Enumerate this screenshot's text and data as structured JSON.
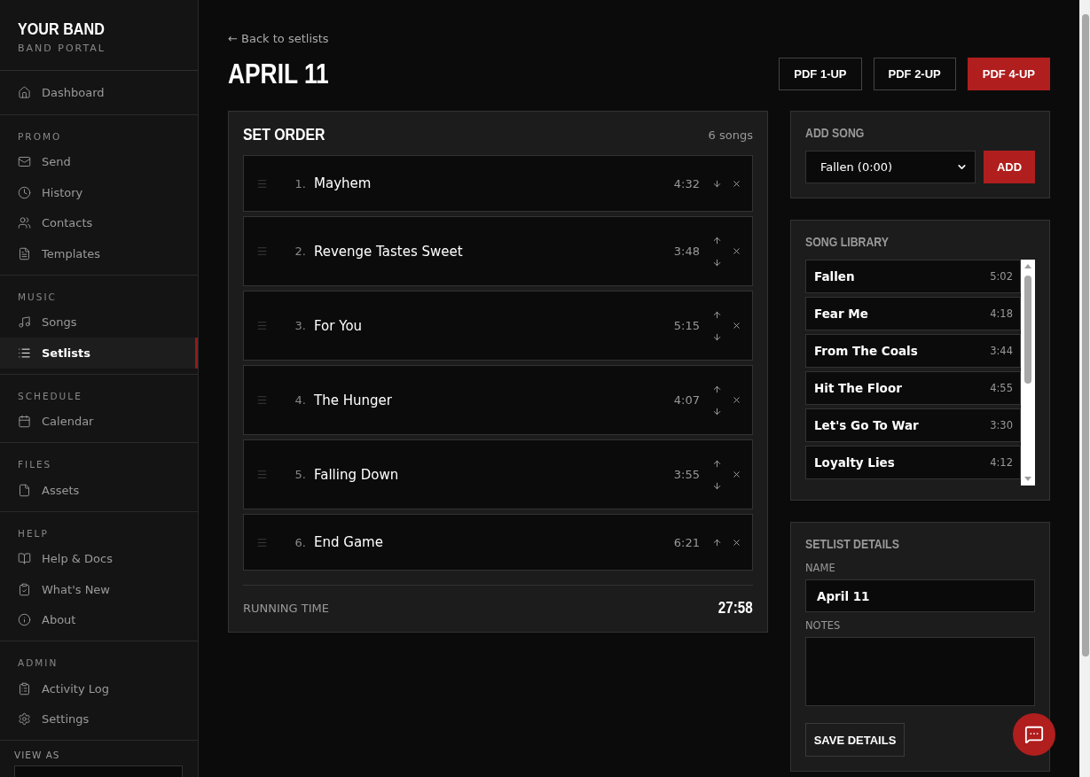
{
  "brand": {
    "title": "YOUR BAND",
    "subtitle": "BAND PORTAL"
  },
  "sidebar": {
    "sections": [
      {
        "items": [
          {
            "label": "Dashboard",
            "selected": false
          }
        ]
      },
      {
        "heading": "PROMO",
        "items": [
          {
            "label": "Send",
            "selected": false
          },
          {
            "label": "History",
            "selected": false
          },
          {
            "label": "Contacts",
            "selected": false
          },
          {
            "label": "Templates",
            "selected": false
          }
        ]
      },
      {
        "heading": "MUSIC",
        "items": [
          {
            "label": "Songs",
            "selected": false
          },
          {
            "label": "Setlists",
            "selected": true
          }
        ]
      },
      {
        "heading": "SCHEDULE",
        "items": [
          {
            "label": "Calendar",
            "selected": false
          }
        ]
      },
      {
        "heading": "FILES",
        "items": [
          {
            "label": "Assets",
            "selected": false
          }
        ]
      },
      {
        "heading": "HELP",
        "items": [
          {
            "label": "Help & Docs",
            "selected": false
          },
          {
            "label": "What's New",
            "selected": false
          },
          {
            "label": "About",
            "selected": false
          }
        ]
      },
      {
        "heading": "ADMIN",
        "items": [
          {
            "label": "Activity Log",
            "selected": false
          },
          {
            "label": "Settings",
            "selected": false
          }
        ]
      }
    ],
    "view_as": {
      "label": "VIEW AS"
    }
  },
  "back_link": "← Back to setlists",
  "page_title": "APRIL 11",
  "pdf_buttons": [
    {
      "label": "PDF 1-UP",
      "selected": false
    },
    {
      "label": "PDF 2-UP",
      "selected": false
    },
    {
      "label": "PDF 4-UP",
      "selected": true
    }
  ],
  "set_order": {
    "title": "SET ORDER",
    "count": "6 songs",
    "songs": [
      {
        "number": "1.",
        "title": "Mayhem",
        "duration": "4:32",
        "can_move_up": false,
        "can_move_down": true
      },
      {
        "number": "2.",
        "title": "Revenge Tastes Sweet",
        "duration": "3:48",
        "can_move_up": true,
        "can_move_down": true
      },
      {
        "number": "3.",
        "title": "For You",
        "duration": "5:15",
        "can_move_up": true,
        "can_move_down": true
      },
      {
        "number": "4.",
        "title": "The Hunger",
        "duration": "4:07",
        "can_move_up": true,
        "can_move_down": true
      },
      {
        "number": "5.",
        "title": "Falling Down",
        "duration": "3:55",
        "can_move_up": true,
        "can_move_down": true
      },
      {
        "number": "6.",
        "title": "End Game",
        "duration": "6:21",
        "can_move_up": true,
        "can_move_down": false
      }
    ],
    "running_time_label": "RUNNING TIME",
    "running_time": "27:58"
  },
  "add_song": {
    "title": "ADD SONG",
    "selected_option": "Fallen (0:00)",
    "button": "ADD"
  },
  "song_library": {
    "title": "SONG LIBRARY",
    "songs": [
      {
        "title": "Fallen",
        "duration": "5:02"
      },
      {
        "title": "Fear Me",
        "duration": "4:18"
      },
      {
        "title": "From The Coals",
        "duration": "3:44"
      },
      {
        "title": "Hit The Floor",
        "duration": "4:55"
      },
      {
        "title": "Let's Go To War",
        "duration": "3:30"
      },
      {
        "title": "Loyalty Lies",
        "duration": "4:12"
      }
    ]
  },
  "setlist_details": {
    "title": "SETLIST DETAILS",
    "name_label": "NAME",
    "name_value": "April 11",
    "notes_label": "NOTES",
    "save_button": "SAVE DETAILS"
  }
}
